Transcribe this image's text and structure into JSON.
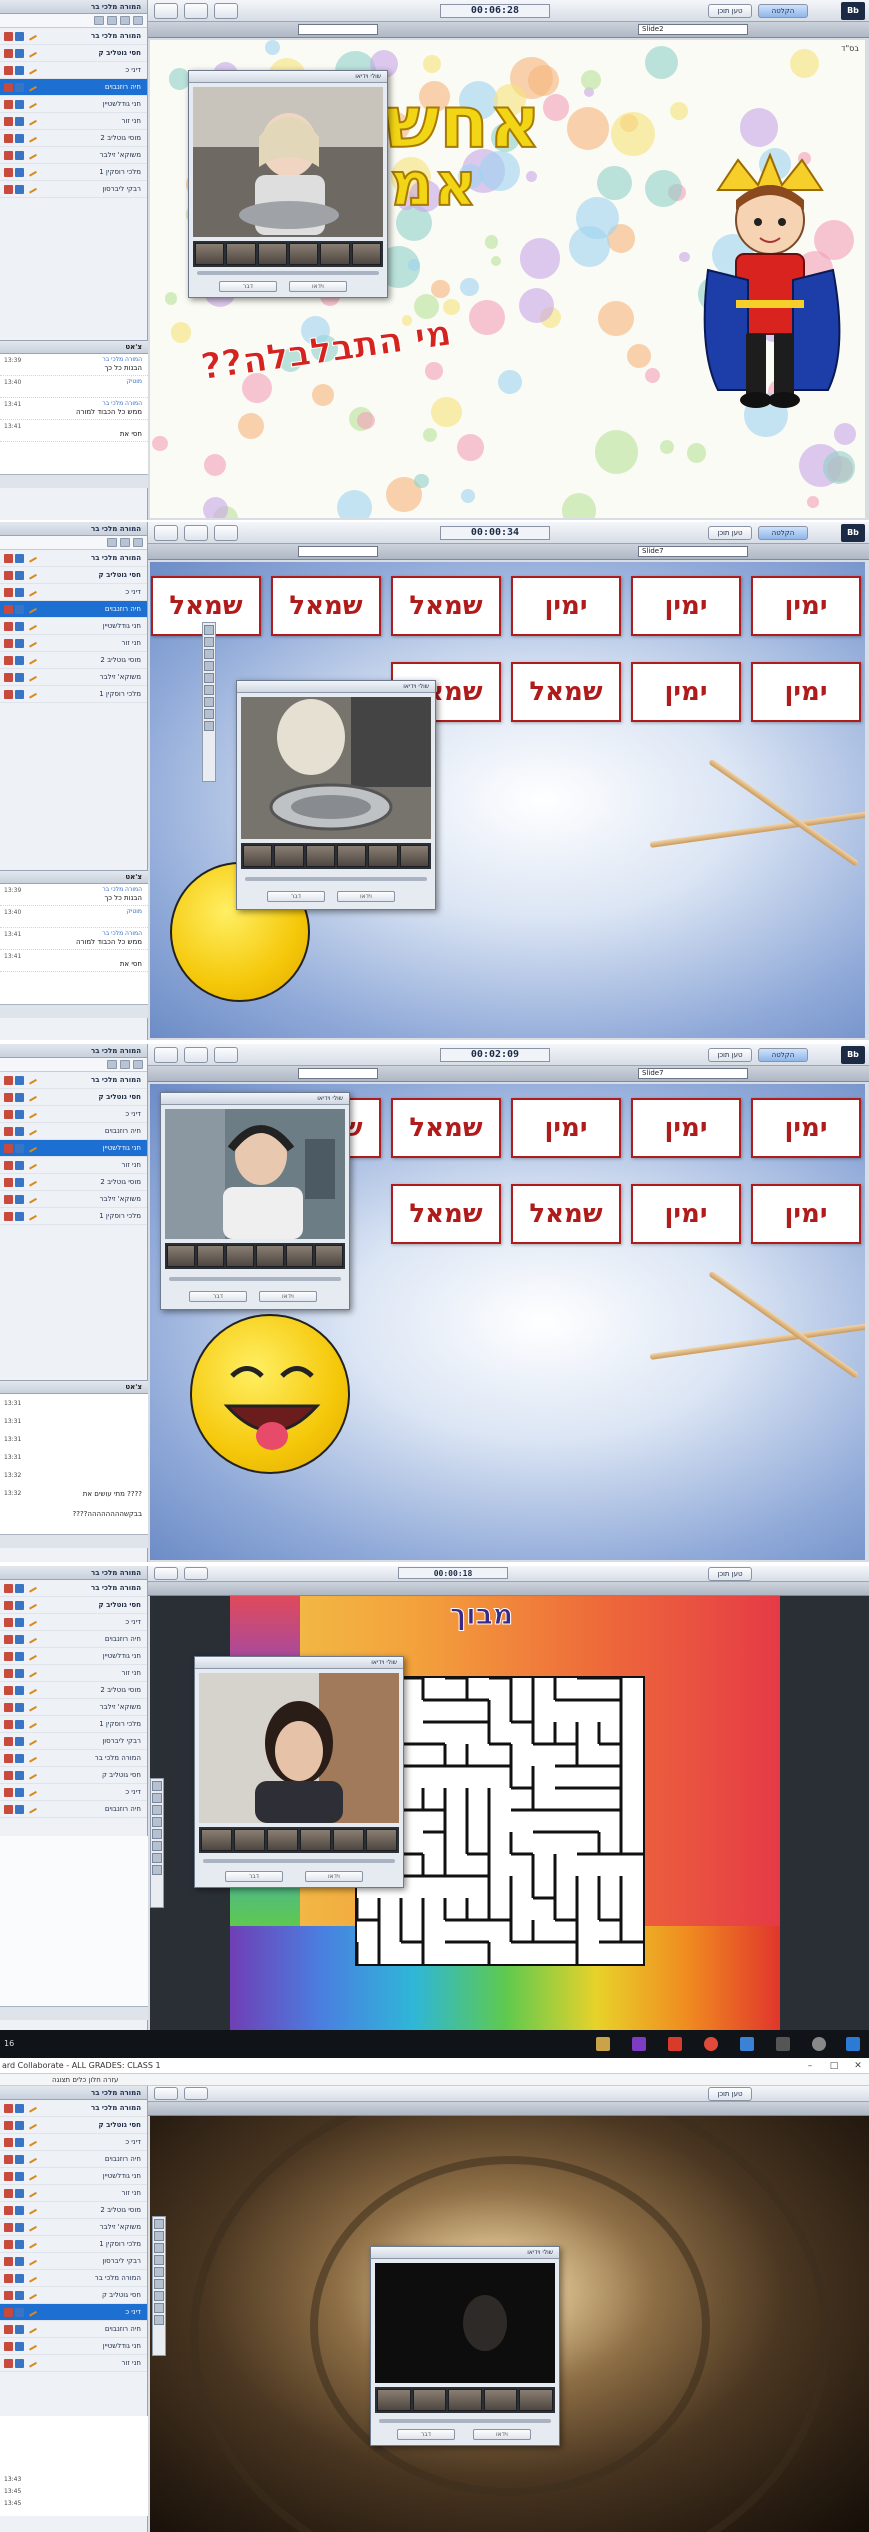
{
  "app": {
    "window_title": "ard Collaborate - ALL GRADES: CLASS 1",
    "menu": "עזרה  חלון  כלים  תצוגה",
    "record_label": "הקלטה",
    "dial_label": "טען תוכן",
    "logo": "Bb"
  },
  "panels": [
    {
      "timer": "00:06:28",
      "slide": "Slide2",
      "participants_header": "המורה מלכי בר",
      "participants": [
        "המורה מלכי בר",
        "חסי גוטליב ק",
        "דיני כ",
        "חיה רוזנבוים",
        "חני גודלשטיין",
        "חני זור",
        "מוסי גוטליב 2",
        "משוקא' זילבר",
        "מלכי רוסקין 1",
        "רבקי ליברסון"
      ],
      "chat_header": "צ'אט",
      "chat": [
        {
          "who": "המורה מלכי בר",
          "text": "הבנות כל כך",
          "time": "13:39"
        },
        {
          "who": "מוטיק",
          "text": "",
          "time": "13:40"
        },
        {
          "who": "המורה מלכי בר",
          "text": "ממש כל הכבוד למורה",
          "time": "13:41"
        },
        {
          "who": "",
          "text": "חסי את",
          "time": "13:41"
        }
      ],
      "video_title": "שולי וידיאו",
      "video_btn_talk": "דבר",
      "video_btn_video": "וידאו",
      "slide_title_line1": "אחשו",
      "slide_title_line2": "אמ",
      "slide_subtitle": "מי התבלבלה??",
      "slide_corner": "בס\"ד"
    },
    {
      "timer": "00:00:34",
      "slide": "Slide7",
      "cards_row1": [
        "ימין",
        "ימין",
        "ימין",
        "שמאל",
        "שמאל",
        "שמאל"
      ],
      "cards_row2": [
        "ימין",
        "ימין",
        "שמאל",
        "שמאל"
      ],
      "chat": [
        {
          "who": "המורה מלכי בר",
          "text": "הבנות כל כך",
          "time": "13:39"
        },
        {
          "who": "מוטיק",
          "text": "",
          "time": "13:40"
        },
        {
          "who": "המורה מלכי בר",
          "text": "ממש כל הכבוד למורה",
          "time": "13:41"
        },
        {
          "who": "",
          "text": "חסי את",
          "time": "13:41"
        }
      ]
    },
    {
      "timer": "00:02:09",
      "slide": "Slide7",
      "cards_row1": [
        "ימין",
        "ימין",
        "ימין",
        "שמאל",
        "שמאל"
      ],
      "cards_row2": [
        "ימין",
        "ימין",
        "שמאל",
        "שמאל"
      ],
      "chat_lines": [
        "13:31",
        "13:31",
        "13:31",
        "13:31",
        "13:32",
        "13:32"
      ],
      "chat_text1": "מתי עושים את ????",
      "chat_text2": "????בבקשהההההההה"
    },
    {
      "timer": "00:00:18",
      "maze_label": "מבוך",
      "taskbar_time": "16"
    },
    {
      "window_title": "ard Collaborate - ALL GRADES: CLASS 1",
      "menu": "עזרה  חלון  כלים  תצוגה",
      "chat_times": [
        "13:43",
        "13:45",
        "13:45"
      ]
    }
  ],
  "colors": {
    "accent": "#1d6fd1",
    "card_red": "#b01b1b",
    "title_yellow": "#f2d515",
    "subtitle_red": "#d5231f"
  }
}
